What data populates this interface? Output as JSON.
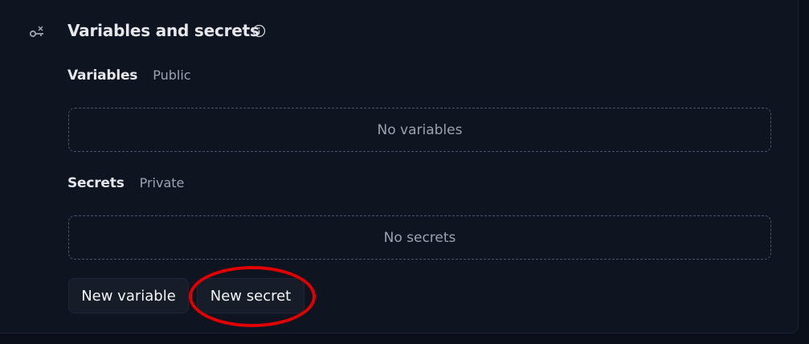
{
  "section": {
    "title": "Variables and secrets",
    "icon": "key-icon",
    "info_icon": "info-icon"
  },
  "variables": {
    "title": "Variables",
    "subtitle": "Public",
    "empty_text": "No variables"
  },
  "secrets": {
    "title": "Secrets",
    "subtitle": "Private",
    "empty_text": "No secrets"
  },
  "actions": {
    "new_variable_label": "New variable",
    "new_secret_label": "New secret"
  },
  "colors": {
    "background": "#0b0f19",
    "highlight": "#e00000"
  }
}
